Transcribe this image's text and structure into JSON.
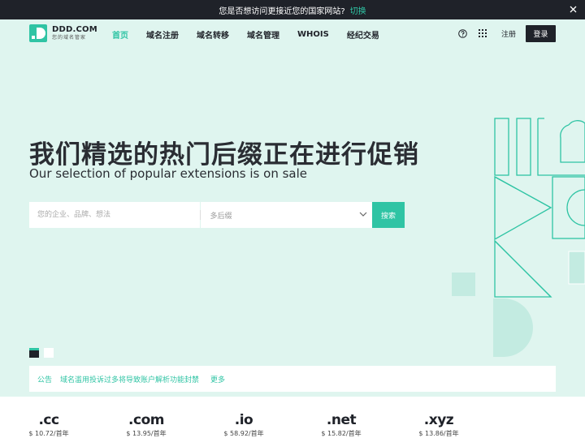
{
  "notice": {
    "text": "您是否想访问更接近您的国家网站?",
    "switch_label": "切换",
    "close_icon": "close-icon"
  },
  "header": {
    "logo_name": "DDD.COM",
    "logo_sub": "您的域名管家",
    "nav": [
      {
        "label": "首页",
        "active": true
      },
      {
        "label": "域名注册",
        "active": false
      },
      {
        "label": "域名转移",
        "active": false
      },
      {
        "label": "域名管理",
        "active": false
      },
      {
        "label": "WHOIS",
        "active": false
      },
      {
        "label": "经纪交易",
        "active": false
      }
    ],
    "help_icon": "help-icon",
    "apps_icon": "grid-icon",
    "register_label": "注册",
    "login_label": "登录"
  },
  "hero": {
    "title": "我们精选的热门后缀正在进行促销",
    "subtitle": "Our selection of popular extensions is on sale"
  },
  "search": {
    "placeholder": "您的企业、品牌、想法",
    "suffix_placeholder": "多后缀",
    "button_label": "搜索"
  },
  "announcement": {
    "tag": "公告",
    "message": "域名滥用投诉过多将导致账户解析功能封禁",
    "more_label": "更多"
  },
  "prices": [
    {
      "ext": ".cc",
      "price": "$ 10.72/首年"
    },
    {
      "ext": ".com",
      "price": "$ 13.95/首年"
    },
    {
      "ext": ".io",
      "price": "$ 58.92/首年"
    },
    {
      "ext": ".net",
      "price": "$ 15.82/首年"
    },
    {
      "ext": ".xyz",
      "price": "$ 13.86/首年"
    }
  ],
  "colors": {
    "accent": "#2fc4a4",
    "dark": "#1f2229",
    "hero_bg": "#dff5ef"
  }
}
